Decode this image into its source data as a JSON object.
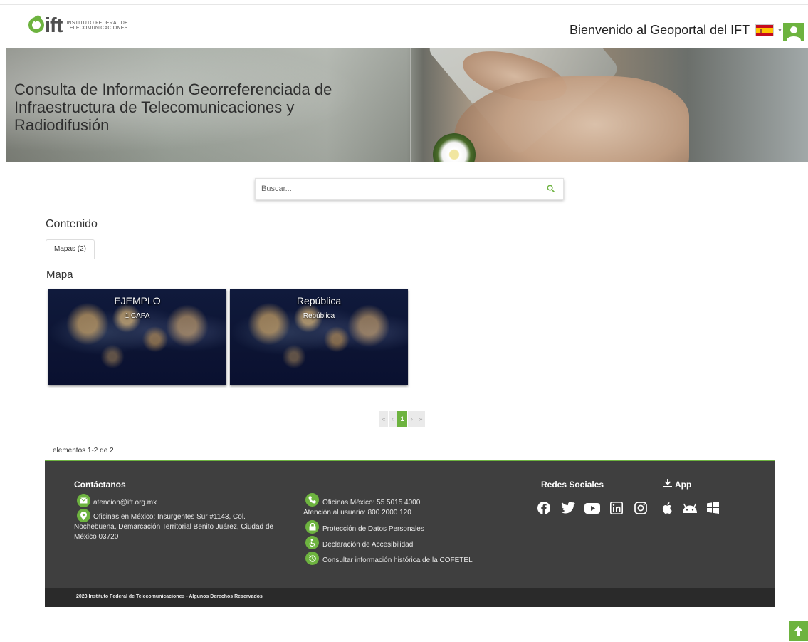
{
  "header": {
    "logo_word": "ift",
    "logo_line1": "INSTITUTO FEDERAL DE",
    "logo_line2": "TELECOMUNICACIONES",
    "welcome": "Bienvenido al Geoportal del IFT",
    "language_flag": "spain-flag-icon",
    "user_icon": "user-icon"
  },
  "banner": {
    "title": "Consulta de Información Georreferenciada de Infraestructura de Telecomunicaciones y Radiodifusión"
  },
  "search": {
    "placeholder": "Buscar...",
    "value": ""
  },
  "content": {
    "title": "Contenido",
    "tabs": [
      {
        "label": "Mapas (2)"
      }
    ],
    "section_title": "Mapa",
    "cards": [
      {
        "title": "EJEMPLO",
        "subtitle": "1 CAPA"
      },
      {
        "title": "República",
        "subtitle": "República"
      }
    ]
  },
  "pagination": {
    "first": "«",
    "prev": "‹",
    "current": "1",
    "next": "›",
    "last": "»",
    "summary": "elementos 1-2 de 2"
  },
  "footer": {
    "contact_heading": "Contáctanos",
    "email": "atencion@ift.org.mx",
    "address": "Oficinas en México: Insurgentes Sur #1143, Col. Nochebuena, Demarcación Territorial Benito Juárez, Ciudad de México 03720",
    "phone": "Oficinas México: 55 5015 4000",
    "user_attention": "Atención al usuario: 800 2000 120",
    "links": [
      "Protección de Datos Personales",
      "Declaración de Accesibilidad",
      "Consultar información histórica de la COFETEL"
    ],
    "social_heading": "Redes Sociales",
    "app_heading": "App",
    "social_icons": [
      "facebook-icon",
      "twitter-icon",
      "youtube-icon",
      "linkedin-icon",
      "instagram-icon"
    ],
    "app_icons": [
      "apple-icon",
      "android-icon",
      "windows-icon"
    ],
    "copyright": "2023 Instituto Federal de Telecomunicaciones - Algunos Derechos Reservados"
  },
  "colors": {
    "accent": "#6db33f",
    "footer_bg": "#3f3f3f",
    "footer_bottom": "#2a2a2a"
  }
}
